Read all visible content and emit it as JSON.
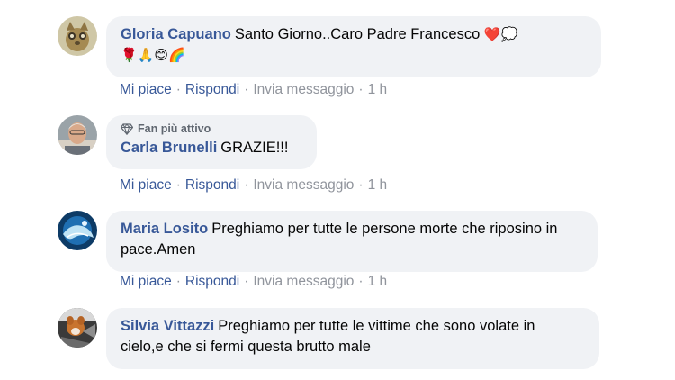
{
  "comments": [
    {
      "author": "Gloria Capuano",
      "text": "Santo Giorno..Caro Padre Francesco",
      "emoji_line1": "❤️",
      "emoji_line1_extra": "💭",
      "emoji_line2": "🌹🙏😊🌈",
      "actions": {
        "like": "Mi piace",
        "reply": "Rispondi",
        "message": "Invia messaggio",
        "time": "1 h"
      }
    },
    {
      "badge": "Fan più attivo",
      "author": "Carla Brunelli",
      "text": "GRAZIE!!!",
      "actions": {
        "like": "Mi piace",
        "reply": "Rispondi",
        "message": "Invia messaggio",
        "time": "1 h"
      }
    },
    {
      "author": "Maria Losito",
      "text": "Preghiamo per tutte le persone morte che riposino in pace.Amen",
      "actions": {
        "like": "Mi piace",
        "reply": "Rispondi",
        "message": "Invia messaggio",
        "time": "1 h"
      }
    },
    {
      "author": "Silvia Vittazzi",
      "text": "Preghiamo per tutte le vittime che sono volate in cielo,e che si fermi questa brutto male"
    }
  ],
  "separator": "·",
  "colors": {
    "link": "#385898",
    "meta": "#90949c",
    "bubble": "#f0f2f5"
  }
}
